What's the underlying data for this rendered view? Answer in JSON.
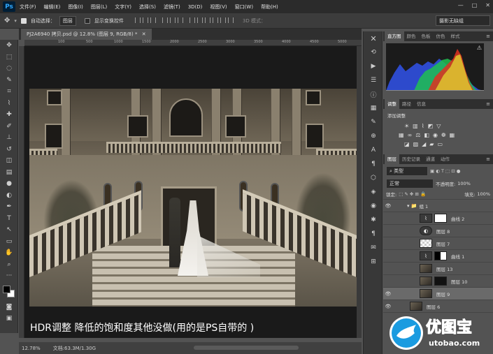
{
  "app": {
    "logo": "Ps"
  },
  "menu": [
    "文件(F)",
    "编辑(E)",
    "图像(I)",
    "图层(L)",
    "文字(Y)",
    "选择(S)",
    "滤镜(T)",
    "3D(D)",
    "视图(V)",
    "窗口(W)",
    "帮助(H)"
  ],
  "window_controls": [
    "—",
    "□",
    "✕"
  ],
  "options": {
    "auto_select_label": "自动选择：",
    "auto_select_value": "图层",
    "show_transform_label": "显示变换控件",
    "mode_3d": "3D 模式：",
    "workspace": "摄影无缺组"
  },
  "document": {
    "tab_title": "PJ2A6940 拷贝.psd @ 12.8% (图层 9, RGB/8) *",
    "ruler_marks": [
      "100",
      "500",
      "1000",
      "1500",
      "2000",
      "2500",
      "3000",
      "3500",
      "4000",
      "4500",
      "5000"
    ],
    "caption": "HDR调整  降低的饱和度其他没做(用的是PS自带的 )"
  },
  "status": {
    "zoom": "12.78%",
    "doc_size": "文档:63.3M/1.30G"
  },
  "panels": {
    "top_tabs": [
      "直方图",
      "颜色",
      "色板",
      "仿色",
      "样式"
    ],
    "adjust_tabs": [
      "调整",
      "路径",
      "信息"
    ],
    "adjust_title": "添加调整",
    "layers_tabs": [
      "图层",
      "历史记录",
      "通道",
      "动作"
    ],
    "kind_filter": "类型",
    "blend_mode": "正常",
    "opacity_label": "不透明度:",
    "opacity_value": "100%",
    "lock_label": "锁定:",
    "fill_label": "填充:",
    "fill_value": "100%"
  },
  "layers": [
    {
      "name": "组 1",
      "type": "group",
      "visible": true
    },
    {
      "name": "曲线 2",
      "type": "adjust-white",
      "visible": false
    },
    {
      "name": "图层 8",
      "type": "checker",
      "visible": false
    },
    {
      "name": "图层 7",
      "type": "checker",
      "visible": false
    },
    {
      "name": "曲线 1",
      "type": "adjust-mask",
      "visible": false
    },
    {
      "name": "图层 13",
      "type": "photo",
      "visible": false
    },
    {
      "name": "图层 10",
      "type": "photo-mask",
      "visible": false
    },
    {
      "name": "图层 9",
      "type": "photo",
      "visible": true
    },
    {
      "name": "图层 6",
      "type": "photo",
      "visible": true
    }
  ],
  "watermark": {
    "brand": "优图宝",
    "url": "utobao.com"
  }
}
